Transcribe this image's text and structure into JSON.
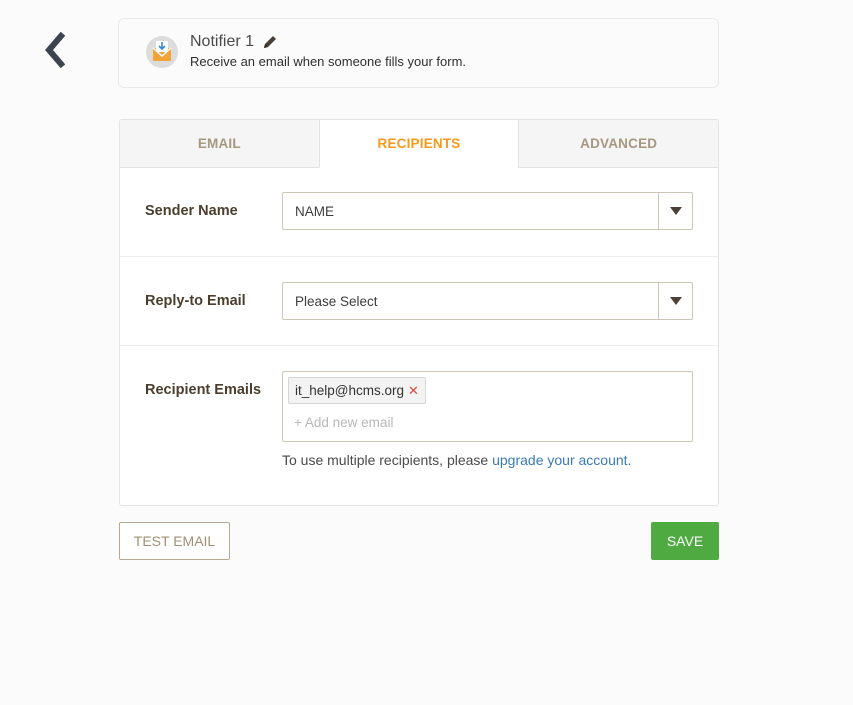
{
  "notifier": {
    "title": "Notifier 1",
    "subtitle": "Receive an email when someone fills your form."
  },
  "tabs": [
    {
      "label": "EMAIL",
      "active": false
    },
    {
      "label": "RECIPIENTS",
      "active": true
    },
    {
      "label": "ADVANCED",
      "active": false
    }
  ],
  "form": {
    "sender_name": {
      "label": "Sender Name",
      "value": "NAME"
    },
    "reply_to": {
      "label": "Reply-to Email",
      "value": "Please Select"
    },
    "recipients": {
      "label": "Recipient Emails",
      "tags": [
        "it_help@hcms.org"
      ],
      "add_placeholder": "+ Add new email",
      "hint_text": "To use multiple recipients, please ",
      "hint_link": "upgrade your account."
    }
  },
  "buttons": {
    "test_email": "TEST EMAIL",
    "save": "SAVE"
  },
  "colors": {
    "accent": "#f59a1b",
    "save": "#4faa41",
    "link": "#3a7ab8",
    "tag_remove": "#e0493a"
  },
  "icons": [
    "back-chevron-icon",
    "email-notification-icon",
    "pencil-edit-icon",
    "dropdown-arrow-icon",
    "remove-x-icon"
  ]
}
